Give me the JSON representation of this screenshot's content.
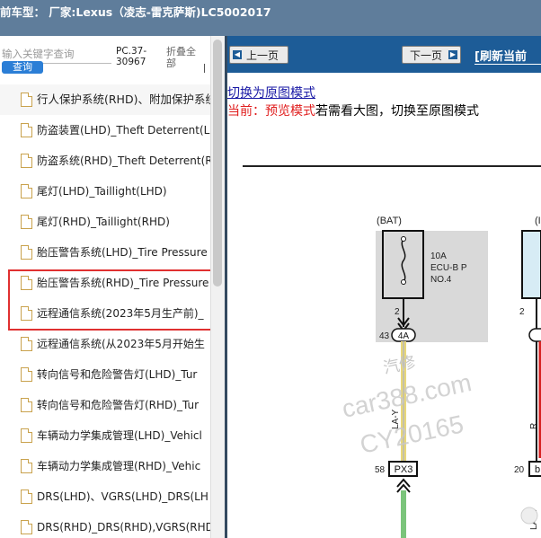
{
  "title": {
    "text": "前车型：  厂家:Lexus（凌志-雷克萨斯)LC5002017"
  },
  "sidebar": {
    "search_placeholder": "输入关键字查询",
    "search_button": "查询",
    "code": "PC.37-30967",
    "fold": "折叠全部",
    "items": [
      {
        "label": "行人保护系统(RHD)、附加保护系统"
      },
      {
        "label": "防盗装置(LHD)_Theft Deterrent(LH"
      },
      {
        "label": "防盗系统(RHD)_Theft Deterrent(RH"
      },
      {
        "label": "尾灯(LHD)_Taillight(LHD)"
      },
      {
        "label": "尾灯(RHD)_Taillight(RHD)"
      },
      {
        "label": "胎压警告系统(LHD)_Tire Pressure"
      },
      {
        "label": "胎压警告系统(RHD)_Tire Pressure"
      },
      {
        "label": "远程通信系统(2023年5月生产前)_"
      },
      {
        "label": "远程通信系统(从2023年5月开始生"
      },
      {
        "label": "转向信号和危险警告灯(LHD)_Tur"
      },
      {
        "label": "转向信号和危险警告灯(RHD)_Tur"
      },
      {
        "label": "车辆动力学集成管理(LHD)_Vehicl"
      },
      {
        "label": "车辆动力学集成管理(RHD)_Vehic"
      },
      {
        "label": "DRS(LHD)、VGRS(LHD)_DRS(LH"
      },
      {
        "label": "DRS(RHD)_DRS(RHD),VGRS(RHD"
      }
    ]
  },
  "viewer": {
    "prev_button": "上一页",
    "next_button": "下一页",
    "refresh": "[刷新当前",
    "switch_link": "切换为原图模式",
    "current_label": "当前：预览模式",
    "current_text": "若需看大图，切换至原图模式"
  },
  "diagram": {
    "bat": "(BAT)",
    "ig_partial": "(I",
    "fuse_amp": "10A",
    "fuse_name": "ECU-B P",
    "fuse_no": "NO.4",
    "pin_2a": "2",
    "pin_43": "43",
    "conn_4a": "4A",
    "wire_lay": "LA-Y",
    "pin_58": "58",
    "conn_px3": "PX3",
    "pin_2b": "2",
    "wire_r": "R",
    "pin_20": "20",
    "conn_b": "b",
    "wire_lar": "LA-R",
    "watermark_1": "汽修",
    "watermark_2": "car388.com",
    "watermark_3": "CY20165"
  }
}
